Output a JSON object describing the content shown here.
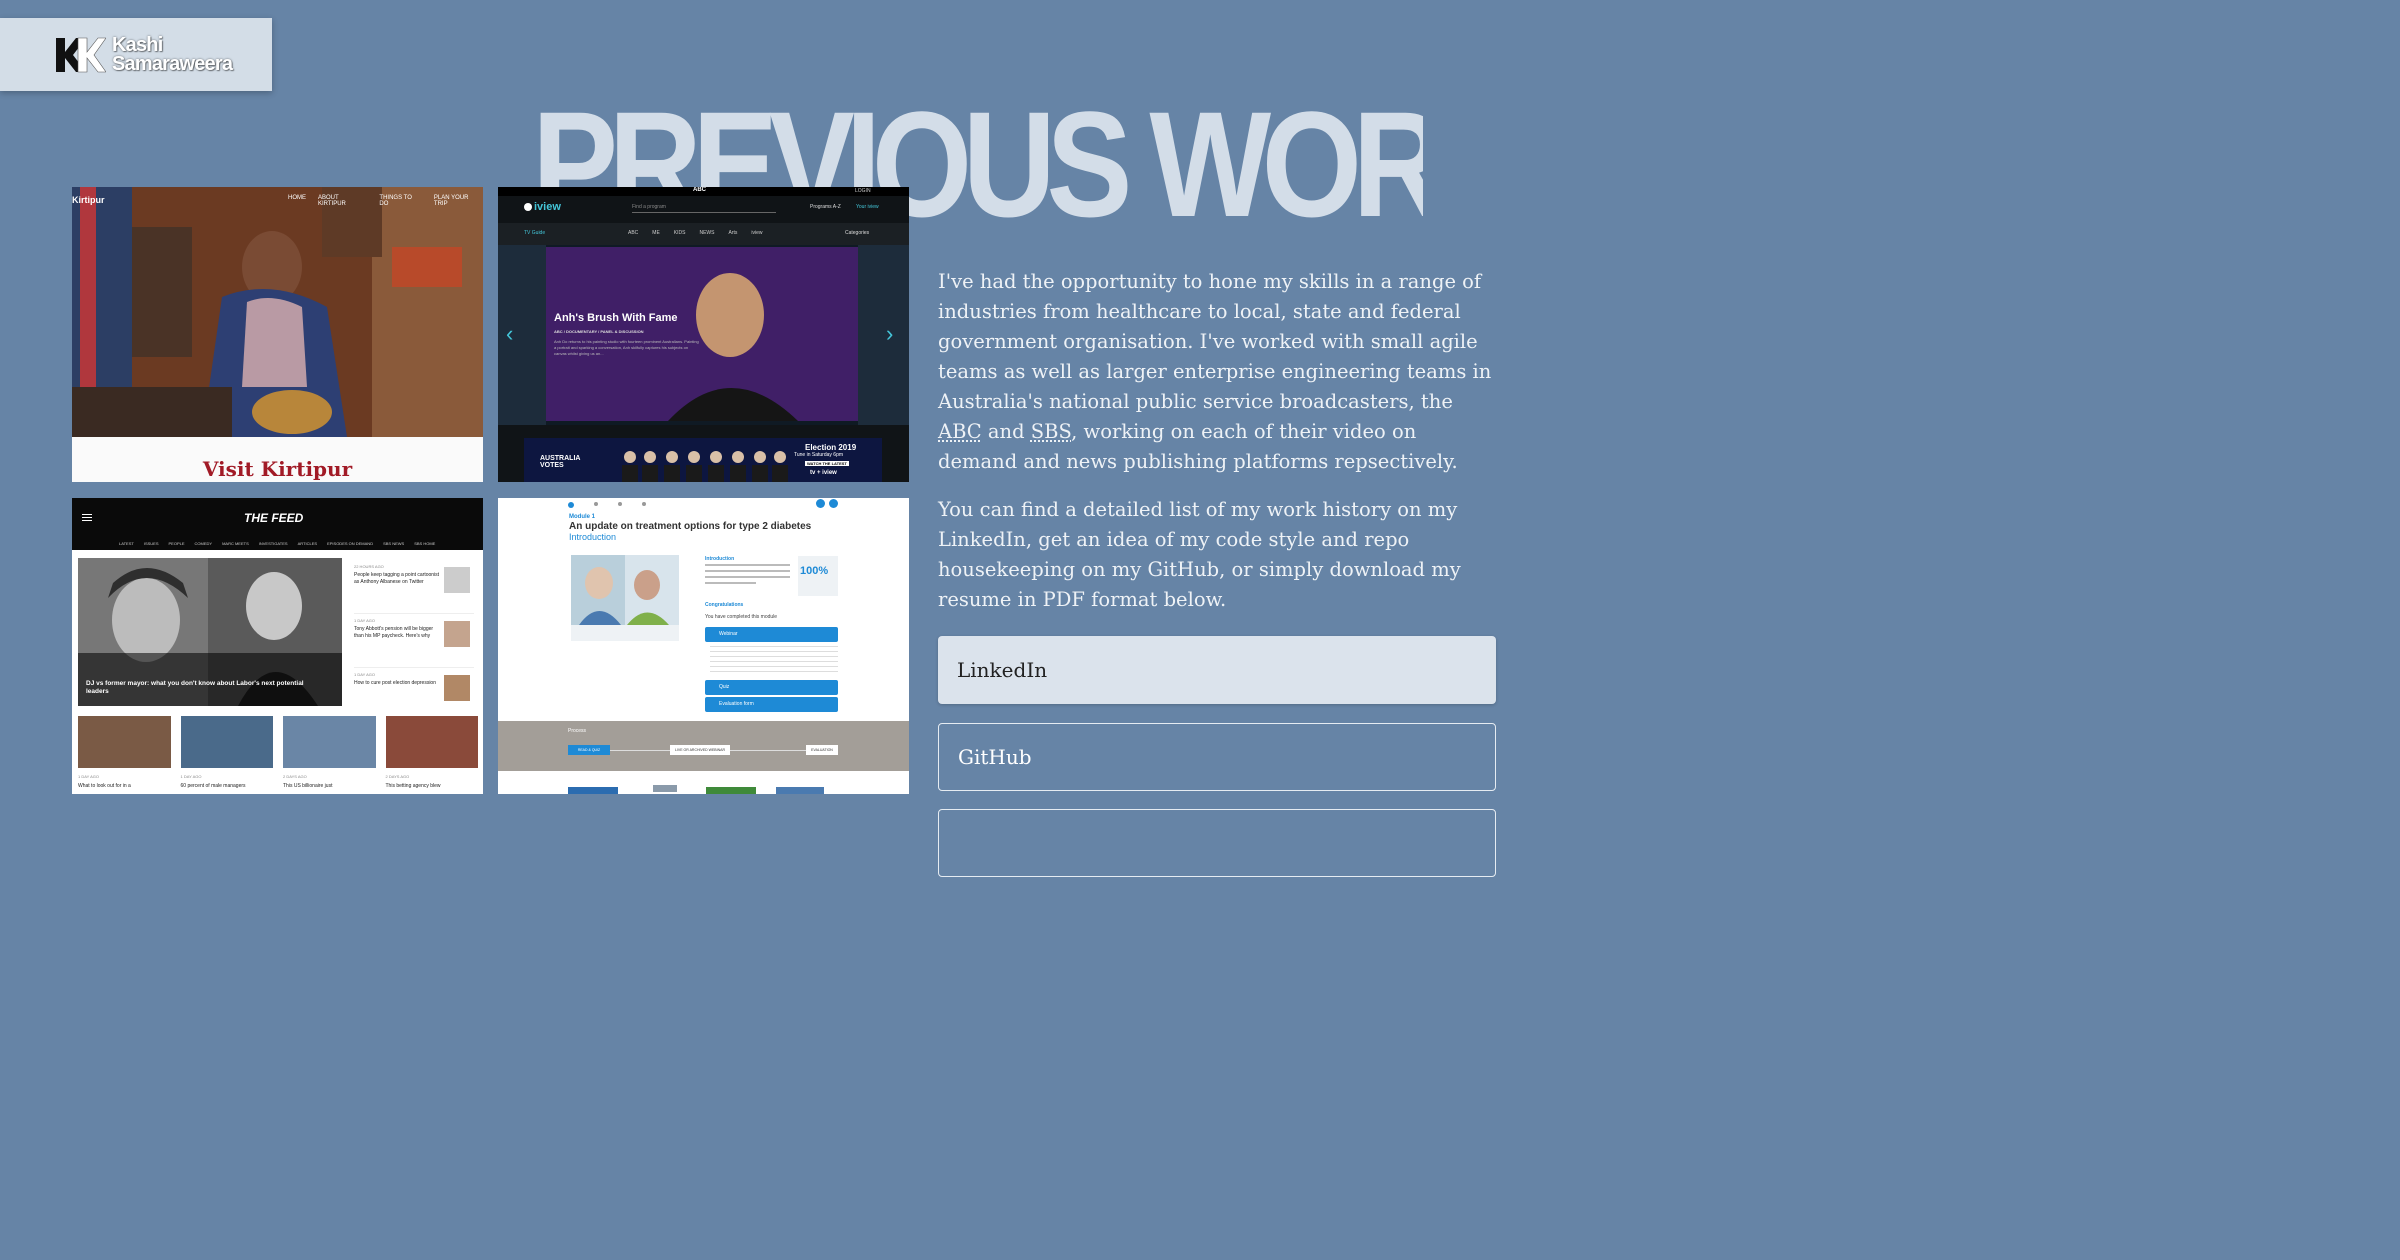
{
  "logo": {
    "name_line1": "Kashi",
    "name_line2": "Samaraweera"
  },
  "heading": "PREVIOUS WORK",
  "intro": {
    "p1_before_abbc": "I've had the opportunity to hone my skills in a range of industries from healthcare to local, state and federal government organisation. I've worked with small agile teams as well as larger enterprise engineering teams in Australia's national public service broadcasters, the ",
    "abbr_abc": "ABC",
    "p1_and": " and ",
    "abbr_sbs": "SBS",
    "p1_after": ", working on each of their video on demand and news publishing platforms repsectively.",
    "p2": "You can find a detailed list of my work history on my LinkedIn, get an idea of my code style and repo housekeeping on my GitHub, or simply download my resume in PDF format below."
  },
  "buttons": {
    "linkedin": "LinkedIn",
    "github": "GitHub"
  },
  "projects": {
    "kirtipur": {
      "brand": "Kirtipur",
      "nav": [
        "HOME",
        "ABOUT KIRTIPUR",
        "THINGS TO DO",
        "PLAN YOUR TRIP"
      ],
      "title": "Visit Kirtipur"
    },
    "iview": {
      "network": "ABC",
      "login": "LOGIN",
      "brand": "iview",
      "search_placeholder": "Find a program",
      "programs": "Programs A-Z",
      "your_iview": "Your iview",
      "tv_guide": "TV Guide",
      "categories": "Categories",
      "channels": [
        "ABC",
        "ME",
        "KIDS",
        "NEWS",
        "Arts",
        "iview"
      ],
      "hero_title": "Anh's Brush With Fame",
      "hero_meta": "ABC  /  DOCUMENTARY  /  PANEL & DISCUSSION",
      "hero_desc": "Anh Do returns to his painting studio with fourteen prominent Australians. Painting a portrait and sparking a conversation, Anh skilfully captures his subjects on canvas whilst giving us an...",
      "banner_left": "AUSTRALIA VOTES",
      "banner_title": "Election 2019",
      "banner_sub": "Tune in Saturday 6pm",
      "banner_cta": "WATCH THE LATEST",
      "banner_logo": "tv + iview"
    },
    "feed": {
      "brand": "THE FEED",
      "nav": [
        "LATEST",
        "ISSUES",
        "PEOPLE",
        "COMEDY",
        "MARC MEETS",
        "INVESTIGATES",
        "ARTICLES",
        "EPISODES ON DEMAND",
        "SBS NEWS",
        "SBS HOME"
      ],
      "hero_caption": "DJ vs former mayor: what you don't know about Labor's next potential leaders",
      "side": [
        {
          "time": "22 HOURS AGO",
          "text": "People keep tagging a point cartoonist as Anthony Albanese on Twitter"
        },
        {
          "time": "1 DAY AGO",
          "text": "Tony Abbott's pension will be bigger than his MP paycheck. Here's why"
        },
        {
          "time": "1 DAY AGO",
          "text": "How to cure post election depression"
        }
      ],
      "cards": [
        {
          "time": "1 DAY AGO",
          "text": "What to look out for in a"
        },
        {
          "time": "1 DAY AGO",
          "text": "60 percent of male managers"
        },
        {
          "time": "2 DAYS AGO",
          "text": "This US billionaire just"
        },
        {
          "time": "2 DAYS AGO",
          "text": "This betting agency blew"
        }
      ]
    },
    "diabetes": {
      "module": "Module 1",
      "title": "An update on treatment options for type 2 diabetes",
      "subtitle": "Introduction",
      "intro_label": "Introduction",
      "percent": "100%",
      "congrats": "Congratulations",
      "completed": "You have completed this module",
      "webinar": "Webinar",
      "quiz": "Quiz",
      "evaluation": "Evaluation form",
      "process": "Process",
      "steps": [
        "READ & QUIZ",
        "LIVE OR ARCHIVED WEBINAR",
        "EVALUATION"
      ]
    }
  },
  "colors": {
    "background": "#6684a6",
    "heading": "#d3dde8",
    "logo_bg": "#d3dde7",
    "button_primary": "#dbe3ec"
  }
}
